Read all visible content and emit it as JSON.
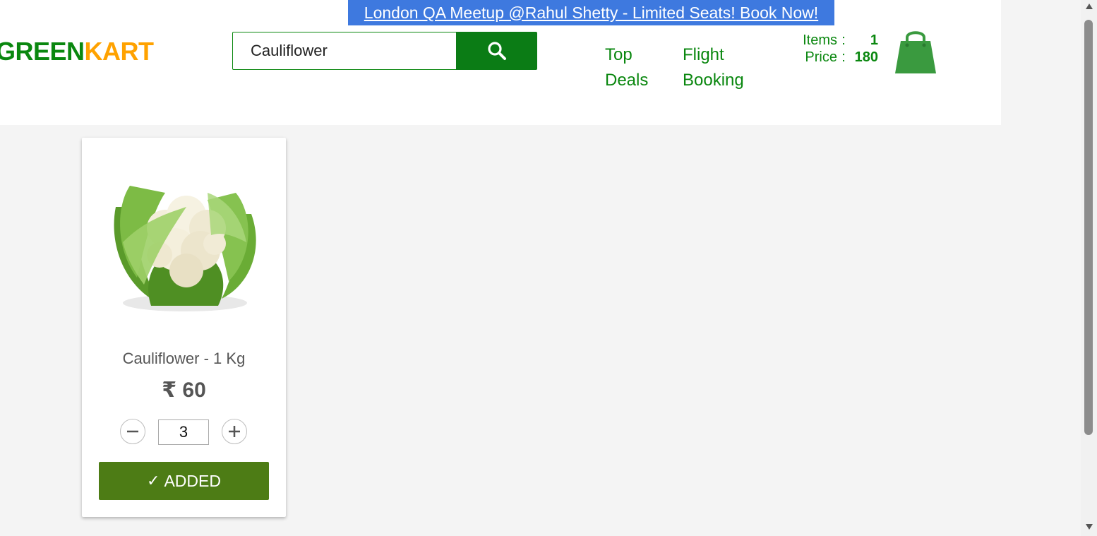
{
  "promo": {
    "text": "London QA Meetup @Rahul Shetty - Limited Seats! Book Now!"
  },
  "logo": {
    "part1": "GREEN",
    "part2": "KART"
  },
  "search": {
    "value": "Cauliflower"
  },
  "nav": {
    "top_deals": [
      "Top",
      "Deals"
    ],
    "flight_booking": [
      "Flight",
      "Booking"
    ]
  },
  "cart": {
    "items_label": "Items",
    "items_value": "1",
    "price_label": "Price",
    "price_value": "180",
    "separator": ":"
  },
  "product": {
    "name": "Cauliflower - 1 Kg",
    "price": "₹ 60",
    "quantity": "3",
    "button_label": "ADDED",
    "button_check": "✓"
  },
  "colors": {
    "brand_green": "#0a870f",
    "brand_orange": "#ffa200",
    "promo_blue": "#3e79df",
    "added_button": "#4d7c15",
    "background": "#f4f4f4"
  },
  "icons": {
    "search": "search-icon",
    "cart": "shopping-bag-icon",
    "decrement": "minus-icon",
    "increment": "plus-icon"
  }
}
